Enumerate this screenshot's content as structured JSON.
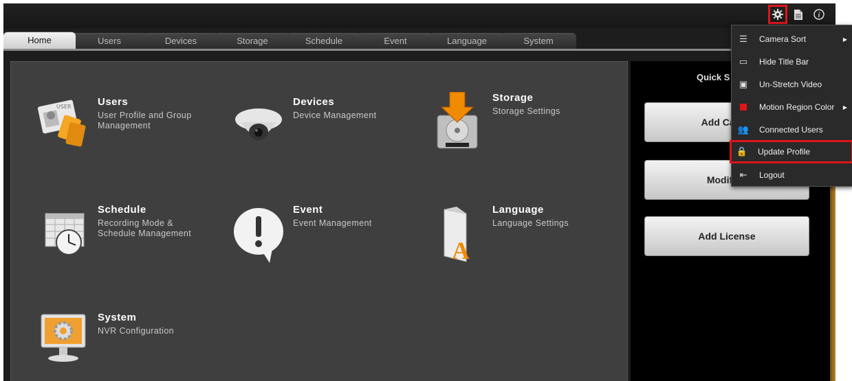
{
  "tabs": [
    "Home",
    "Users",
    "Devices",
    "Storage",
    "Schedule",
    "Event",
    "Language",
    "System"
  ],
  "active_tab": "Home",
  "tiles": [
    {
      "title": "Users",
      "desc": "User Profile and Group Management",
      "icon": "users-card-icon"
    },
    {
      "title": "Devices",
      "desc": "Device Management",
      "icon": "dome-camera-icon"
    },
    {
      "title": "Storage",
      "desc": "Storage Settings",
      "icon": "hard-drive-icon"
    },
    {
      "title": "Schedule",
      "desc": "Recording Mode & Schedule Management",
      "icon": "calendar-clock-icon"
    },
    {
      "title": "Event",
      "desc": "Event Management",
      "icon": "alert-bubble-icon"
    },
    {
      "title": "Language",
      "desc": "Language Settings",
      "icon": "language-folder-icon"
    },
    {
      "title": "System",
      "desc": "NVR Configuration",
      "icon": "monitor-gear-icon"
    }
  ],
  "quick": {
    "title": "Quick S",
    "buttons": [
      "Add Camer",
      "Modify S",
      "Add License"
    ]
  },
  "top_icons": [
    "gear-icon",
    "document-icon",
    "info-icon"
  ],
  "menu": {
    "items": [
      {
        "label": "Camera Sort",
        "icon": "list-icon",
        "has_submenu": true
      },
      {
        "label": "Hide Title Bar",
        "icon": "window-icon",
        "has_submenu": false
      },
      {
        "label": "Un-Stretch Video",
        "icon": "video-frame-icon",
        "has_submenu": false
      },
      {
        "label": "Motion Region Color",
        "icon": "red-square-icon",
        "has_submenu": true
      },
      {
        "label": "Connected Users",
        "icon": "users-icon",
        "has_submenu": false
      },
      {
        "label": "Update Profile",
        "icon": "lock-icon",
        "has_submenu": false
      },
      {
        "label": "Logout",
        "icon": "logout-icon",
        "has_submenu": false
      }
    ],
    "highlighted": "Update Profile"
  },
  "colors": {
    "highlight": "#e0141b",
    "accent_orange": "#f08a00"
  }
}
